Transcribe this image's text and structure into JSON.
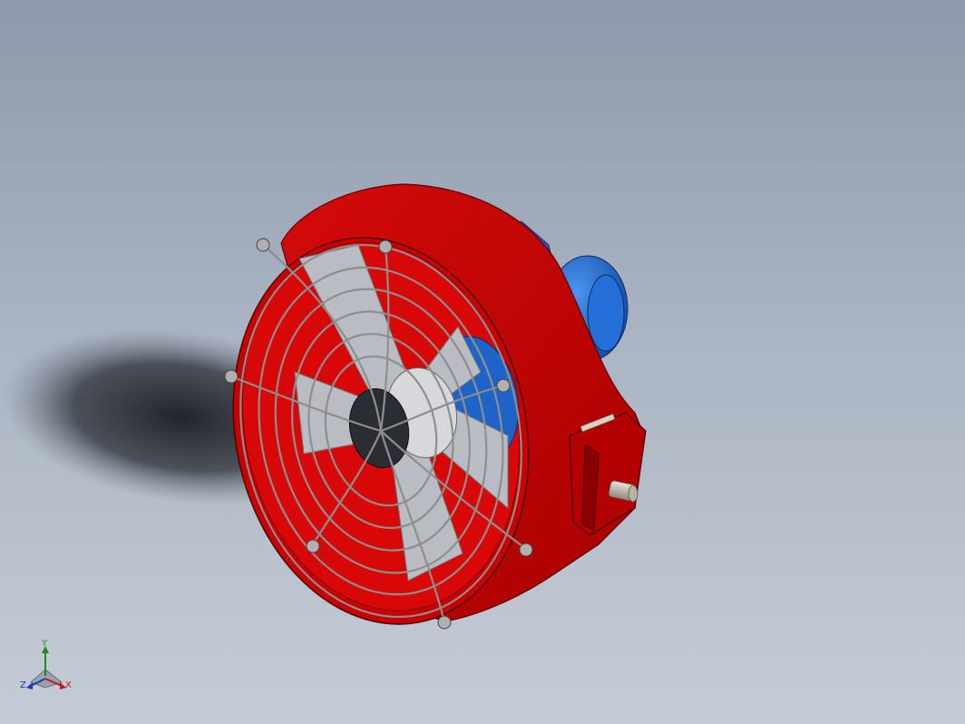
{
  "viewport": {
    "background_top": "#8e9aab",
    "background_bottom": "#c6ccd6"
  },
  "model": {
    "housing_color": "#c40000",
    "housing_shade": "#8a0000",
    "motor_color": "#1f6fd6",
    "guard_color": "#9a9a9a",
    "blade_color": "#b9bdc3",
    "hub_color": "#2a2d33",
    "shaft_color": "#c9c4b6"
  },
  "triad": {
    "x_label": "X",
    "y_label": "Y",
    "z_label": "Z",
    "x_color": "#c01818",
    "y_color": "#1a8a1a",
    "z_color": "#1a3ab8"
  }
}
